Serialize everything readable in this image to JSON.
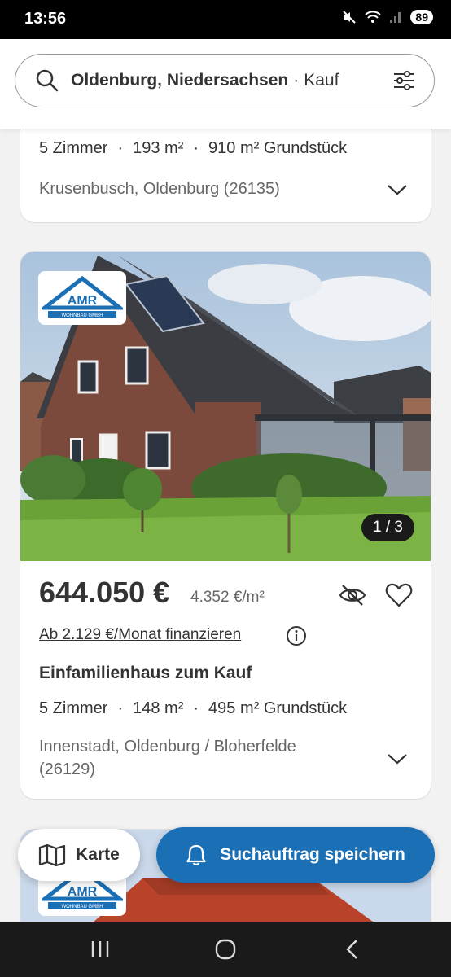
{
  "status": {
    "time": "13:56",
    "battery": "89"
  },
  "search": {
    "query": "Oldenburg, Niedersachsen",
    "separator": "·",
    "mode": "Kauf"
  },
  "listings": [
    {
      "rooms": "5 Zimmer",
      "area": "193 m²",
      "plot": "910 m² Grundstück",
      "location": "Krusenbusch, Oldenburg (26135)"
    },
    {
      "logo_text": "AMR",
      "logo_subtext": "WOHNBAU GMBH",
      "photo_counter": "1 / 3",
      "price": "644.050 €",
      "price_per_sqm": "4.352 €/m²",
      "finance_link": "Ab 2.129 €/Monat finanzieren",
      "title": "Einfamilienhaus zum Kauf",
      "rooms": "5 Zimmer",
      "area": "148 m²",
      "plot": "495 m² Grundstück",
      "location": "Innenstadt, Oldenburg / Bloherfelde (26129)"
    },
    {
      "logo_text": "AMR",
      "logo_subtext": "WOHNBAU GMBH"
    }
  ],
  "actions": {
    "map_label": "Karte",
    "save_search_label": "Suchauftrag speichern"
  },
  "fact_separator": "·",
  "colors": {
    "primary": "#1b6fb5",
    "text": "#333333",
    "muted": "#666666"
  }
}
